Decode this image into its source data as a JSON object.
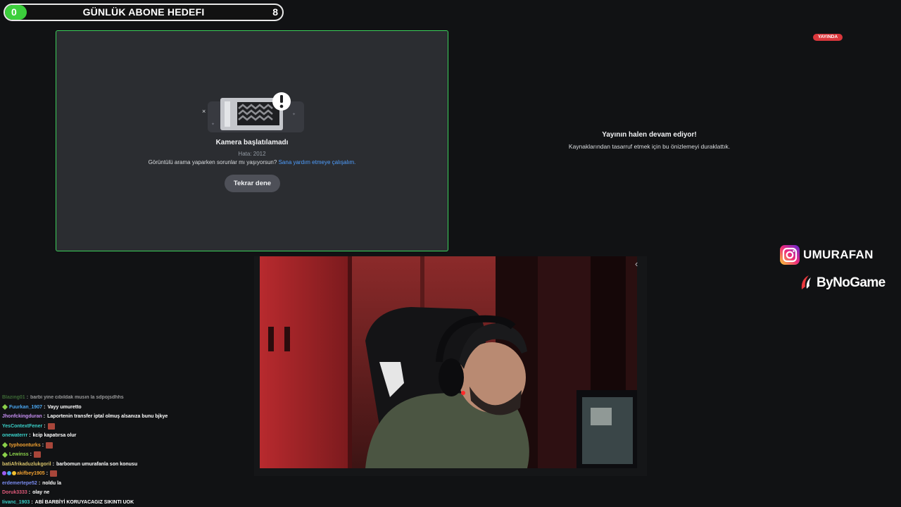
{
  "goal": {
    "current": "0",
    "title": "GÜNLÜK ABONE HEDEFI",
    "target": "8",
    "progress_fraction": 0,
    "fill_color": "#3ccf3c"
  },
  "camera_error": {
    "title": "Kamera başlatılamadı",
    "code": "Hata: 2012",
    "help_text": "Görüntülü arama yaparken sorunlar mı yaşıyorsun?",
    "help_link": "Sana yardım etmeye çalışalım.",
    "retry_label": "Tekrar dene",
    "border_color": "#3ccf5a"
  },
  "stream_preview": {
    "live_badge": "YAYINDA",
    "paused_title": "Yayının halen devam ediyor!",
    "paused_subtitle": "Kaynaklarından tasarruf etmek için bu önizlemeyi duraklattık."
  },
  "socials": {
    "instagram_handle": "UMURAFAN",
    "instagram_icon": "instagram-icon",
    "sponsor": "ByNoGame",
    "sponsor_icon": "bynogame-logo-icon"
  },
  "webcam": {
    "collapse_icon": "chevron-left-icon",
    "collapse_glyph": "‹"
  },
  "chat": [
    {
      "user": "Blazing01",
      "color": "#5fae4f",
      "text": "barbi yine cıbıldak musın la sdpojsdhhs",
      "badge": "",
      "emote": false,
      "faded": true
    },
    {
      "user": "Fuurkan_1907",
      "color": "#4aa6f0",
      "text": "Vayy umuretto",
      "badge": "green",
      "emote": false,
      "faded": false
    },
    {
      "user": "Jhonfckingduran",
      "color": "#c58ef0",
      "text": "Laportenin transfer iptal olmuş alsanıza bunu bjkye",
      "badge": "",
      "emote": false,
      "faded": false
    },
    {
      "user": "YesContextFener",
      "color": "#39d0c8",
      "text": "",
      "badge": "",
      "emote": true,
      "faded": false
    },
    {
      "user": "onewaterrr",
      "color": "#39d0c8",
      "text": "kcip kapatırsa olur",
      "badge": "",
      "emote": false,
      "faded": false
    },
    {
      "user": "typhoonturks",
      "color": "#f0a030",
      "text": "",
      "badge": "green",
      "emote": true,
      "faded": false
    },
    {
      "user": "Lewinss",
      "color": "#8ad04a",
      "text": "",
      "badge": "green",
      "emote": true,
      "faded": false
    },
    {
      "user": "batiAfrikaduzlukgoril",
      "color": "#d7c26a",
      "text": "barbomun umurafanla son konusu",
      "badge": "",
      "emote": false,
      "faded": false
    },
    {
      "user": "akifbey1905",
      "color": "#f0a030",
      "text": "",
      "badge": "multi",
      "emote": true,
      "faded": false
    },
    {
      "user": "erdemertepe52",
      "color": "#7a8cf0",
      "text": "noldu la",
      "badge": "",
      "emote": false,
      "faded": false
    },
    {
      "user": "Doruk3333",
      "color": "#e05a7a",
      "text": "olay ne",
      "badge": "",
      "emote": false,
      "faded": false
    },
    {
      "user": "Iivanc_1903",
      "color": "#39d0c8",
      "text": "ABİ BARBİYİ KORUYACAGIZ SIKINTI UOK",
      "badge": "",
      "emote": false,
      "faded": false
    }
  ]
}
